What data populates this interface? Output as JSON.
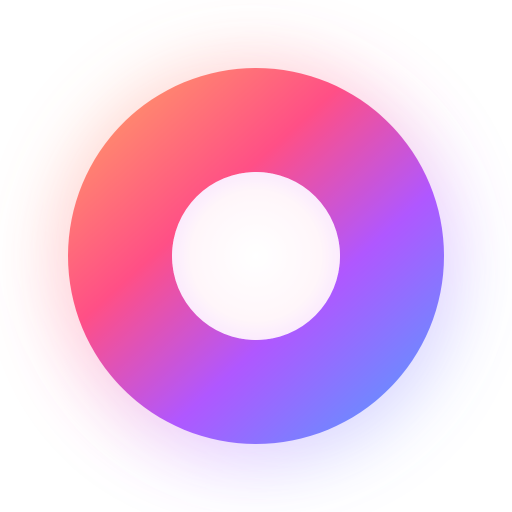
{
  "logo": {
    "name": "gradient-ring-logo",
    "colors": {
      "orange": "#FFB35C",
      "pink": "#FF4F86",
      "purple": "#B057FF",
      "blue": "#3DAEFF",
      "background": "#FFFFFF"
    }
  }
}
